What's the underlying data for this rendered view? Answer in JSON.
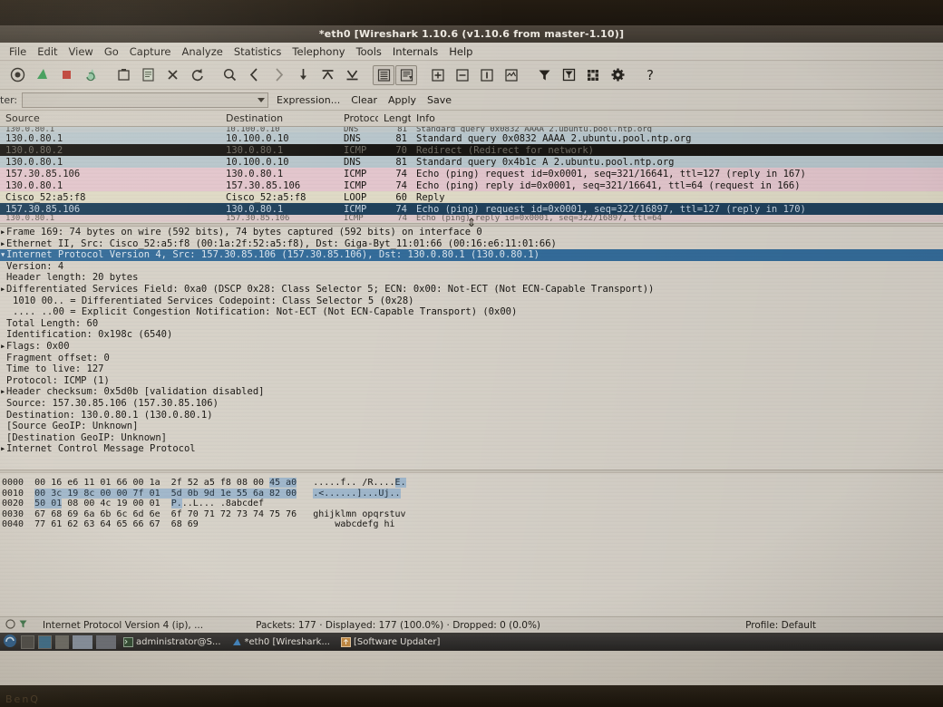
{
  "window": {
    "title": "*eth0  [Wireshark 1.10.6  (v1.10.6 from master-1.10)]"
  },
  "menu": {
    "items": [
      "File",
      "Edit",
      "View",
      "Go",
      "Capture",
      "Analyze",
      "Statistics",
      "Telephony",
      "Tools",
      "Internals",
      "Help"
    ]
  },
  "toolbar": {
    "icons": [
      "list-interfaces-icon",
      "start-capture-icon",
      "stop-capture-icon",
      "restart-capture-icon",
      "open-file-icon",
      "save-file-icon",
      "close-file-icon",
      "reload-icon",
      "find-packet-icon",
      "go-back-icon",
      "go-forward-icon",
      "go-to-packet-icon",
      "go-first-packet-icon",
      "go-last-packet-icon",
      "colorize-icon",
      "autoscroll-icon",
      "zoom-in-icon",
      "zoom-out-icon",
      "zoom-normal-icon",
      "resize-columns-icon",
      "capture-filters-icon",
      "display-filters-icon",
      "coloring-rules-icon",
      "preferences-icon",
      "help-icon"
    ]
  },
  "filter": {
    "label": "ter:",
    "value": "",
    "placeholder": "",
    "expression_label": "Expression...",
    "clear_label": "Clear",
    "apply_label": "Apply",
    "save_label": "Save"
  },
  "packet_list": {
    "columns": [
      "Source",
      "Destination",
      "Protocol",
      "Lengtl",
      "Info"
    ],
    "rows": [
      {
        "source": "130.0.80.1",
        "destination": "10.100.0.10",
        "protocol": "DNS",
        "length": "81",
        "info": "Standard query 0x0832  AAAA 2.ubuntu.pool.ntp.org",
        "style": "dns"
      },
      {
        "source": "130.0.80.2",
        "destination": "130.0.80.1",
        "protocol": "ICMP",
        "length": "70",
        "info": "Redirect                 (Redirect for network)",
        "style": "black"
      },
      {
        "source": "130.0.80.1",
        "destination": "10.100.0.10",
        "protocol": "DNS",
        "length": "81",
        "info": "Standard query 0x4b1c  A 2.ubuntu.pool.ntp.org",
        "style": "dns"
      },
      {
        "source": "157.30.85.106",
        "destination": "130.0.80.1",
        "protocol": "ICMP",
        "length": "74",
        "info": "Echo (ping) request  id=0x0001, seq=321/16641, ttl=127 (reply in 167)",
        "style": "icmp"
      },
      {
        "source": "130.0.80.1",
        "destination": "157.30.85.106",
        "protocol": "ICMP",
        "length": "74",
        "info": "Echo (ping) reply    id=0x0001, seq=321/16641, ttl=64 (request in 166)",
        "style": "icmp"
      },
      {
        "source": "Cisco_52:a5:f8",
        "destination": "Cisco_52:a5:f8",
        "protocol": "LOOP",
        "length": "60",
        "info": "Reply",
        "style": "loop"
      },
      {
        "source": "157.30.85.106",
        "destination": "130.0.80.1",
        "protocol": "ICMP",
        "length": "74",
        "info": "Echo (ping) request  id=0x0001, seq=322/16897, ttl=127 (reply in 170)",
        "style": "selected"
      }
    ]
  },
  "detail_tree": {
    "rows": [
      {
        "indent": 0,
        "arrow": "right",
        "text": "Frame 169: 74 bytes on wire (592 bits), 74 bytes captured (592 bits) on interface 0",
        "selected": false
      },
      {
        "indent": 0,
        "arrow": "right",
        "text": "Ethernet II, Src: Cisco_52:a5:f8 (00:1a:2f:52:a5:f8), Dst: Giga-Byt_11:01:66 (00:16:e6:11:01:66)",
        "selected": false
      },
      {
        "indent": 0,
        "arrow": "down",
        "text": "Internet Protocol Version 4, Src: 157.30.85.106 (157.30.85.106), Dst: 130.0.80.1 (130.0.80.1)",
        "selected": true
      },
      {
        "indent": 1,
        "arrow": "none",
        "text": "Version: 4",
        "selected": false
      },
      {
        "indent": 1,
        "arrow": "none",
        "text": "Header length: 20 bytes",
        "selected": false
      },
      {
        "indent": 1,
        "arrow": "right",
        "text": "Differentiated Services Field: 0xa0 (DSCP 0x28: Class Selector 5; ECN: 0x00: Not-ECT (Not ECN-Capable Transport))",
        "selected": false
      },
      {
        "indent": 2,
        "arrow": "none",
        "text": "1010 00.. = Differentiated Services Codepoint: Class Selector 5 (0x28)",
        "selected": false
      },
      {
        "indent": 2,
        "arrow": "none",
        "text": ".... ..00 = Explicit Congestion Notification: Not-ECT (Not ECN-Capable Transport) (0x00)",
        "selected": false
      },
      {
        "indent": 1,
        "arrow": "none",
        "text": "Total Length: 60",
        "selected": false
      },
      {
        "indent": 1,
        "arrow": "none",
        "text": "Identification: 0x198c (6540)",
        "selected": false
      },
      {
        "indent": 1,
        "arrow": "right",
        "text": "Flags: 0x00",
        "selected": false
      },
      {
        "indent": 1,
        "arrow": "none",
        "text": "Fragment offset: 0",
        "selected": false
      },
      {
        "indent": 1,
        "arrow": "none",
        "text": "Time to live: 127",
        "selected": false
      },
      {
        "indent": 1,
        "arrow": "none",
        "text": "Protocol: ICMP (1)",
        "selected": false
      },
      {
        "indent": 1,
        "arrow": "right",
        "text": "Header checksum: 0x5d0b [validation disabled]",
        "selected": false
      },
      {
        "indent": 1,
        "arrow": "none",
        "text": "Source: 157.30.85.106 (157.30.85.106)",
        "selected": false
      },
      {
        "indent": 1,
        "arrow": "none",
        "text": "Destination: 130.0.80.1 (130.0.80.1)",
        "selected": false
      },
      {
        "indent": 1,
        "arrow": "none",
        "text": "[Source GeoIP: Unknown]",
        "selected": false
      },
      {
        "indent": 1,
        "arrow": "none",
        "text": "[Destination GeoIP: Unknown]",
        "selected": false
      },
      {
        "indent": 0,
        "arrow": "right",
        "text": "Internet Control Message Protocol",
        "selected": false
      }
    ]
  },
  "hex_dump": {
    "rows": [
      {
        "offset": "0000",
        "hex_plain_1": "00 16 e6 11 01 66 00 1a",
        "hex_plain_2": "2f 52 a5 f8 08 00",
        "hex_sel": "45 a0",
        "ascii_plain": ".....f.. /R....",
        "ascii_sel": "E."
      },
      {
        "offset": "0010",
        "hex_plain_1": "",
        "hex_plain_2": "",
        "hex_sel": "00 3c 19 8c 00 00 7f 01  5d 0b 9d 1e 55 6a 82 00",
        "ascii_plain": "",
        "ascii_sel": ".<......]...Uj.."
      },
      {
        "offset": "0020",
        "hex_plain_1": "",
        "hex_plain_2": "08 00 4c 19 00 01",
        "hex_sel": "50 01",
        "ascii_plain": "..L... .8abcdef",
        "ascii_sel": "P."
      },
      {
        "offset": "0030",
        "hex_plain_1": "67 68 69 6a 6b 6c 6d 6e",
        "hex_plain_2": "6f 70 71 72 73 74 75 76",
        "hex_sel": "",
        "ascii_plain": "ghijklmn opqrstuv",
        "ascii_sel": ""
      },
      {
        "offset": "0040",
        "hex_plain_1": "77 61 62 63 64 65 66 67",
        "hex_plain_2": "68 69",
        "hex_sel": "",
        "ascii_plain": "wabcdefg hi",
        "ascii_sel": ""
      }
    ]
  },
  "status_bar": {
    "field_label": "Internet Protocol Version 4 (ip), ...",
    "counts": "Packets: 177 · Displayed: 177 (100.0%) · Dropped: 0 (0.0%)",
    "profile": "Profile: Default"
  },
  "taskbar": {
    "items": [
      {
        "label": "administrator@S...",
        "icon": "terminal-icon"
      },
      {
        "label": "*eth0  [Wireshark...",
        "icon": "wireshark-icon"
      },
      {
        "label": "[Software Updater]",
        "icon": "updater-icon"
      }
    ]
  },
  "colors": {
    "selection_blue": "#1b3f5e",
    "detail_selection_blue": "#2d6ca0",
    "dns_row": "#b9c8cf",
    "icmp_row": "#e8c8cf",
    "loop_row": "#e2ddc6",
    "hex_selection": "#9fb9cf"
  },
  "branding": {
    "monitor": "BenQ"
  }
}
